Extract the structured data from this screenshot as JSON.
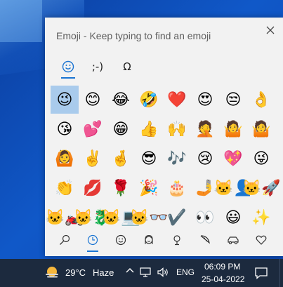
{
  "panel": {
    "title": "Emoji - Keep typing to find an emoji",
    "close_icon": "close-icon"
  },
  "top_tabs": [
    {
      "label": "☺",
      "name": "emoji"
    },
    {
      "label": ";-)",
      "name": "kaomoji"
    },
    {
      "label": "Ω",
      "name": "symbols"
    }
  ],
  "emojis": [
    "😉",
    "😊",
    "😂",
    "🤣",
    "❤️",
    "😍",
    "😒",
    "👌",
    "😘",
    "💕",
    "😁",
    "👍",
    "🙌",
    "🤦",
    "🤷",
    "🤷",
    "🙆",
    "✌️",
    "🤞",
    "😎",
    "🎶",
    "😢",
    "💖",
    "😜",
    "👏",
    "💋",
    "🌹",
    "🎉",
    "🎂",
    "🤳",
    "🐱‍👤",
    "🐱‍🚀",
    "🐱‍🏍",
    "🐱‍🐉",
    "🐱‍💻",
    "🐱‍👓",
    "✔️",
    "👀",
    "😃",
    "✨"
  ],
  "bottom_tabs": [
    {
      "label": "⚲",
      "name": "search"
    },
    {
      "label": "🕓",
      "name": "recent"
    },
    {
      "label": "☺",
      "name": "smileys"
    },
    {
      "label": "☻",
      "name": "people"
    },
    {
      "label": "⚲",
      "name": "places"
    },
    {
      "label": "◭",
      "name": "food"
    },
    {
      "label": "⛟",
      "name": "transport"
    },
    {
      "label": "♡",
      "name": "hearts"
    }
  ],
  "taskbar": {
    "temperature": "29°C",
    "weather": "Haze",
    "chevron": "^",
    "language": "ENG",
    "time": "06:09 PM",
    "date": "25-04-2022"
  }
}
